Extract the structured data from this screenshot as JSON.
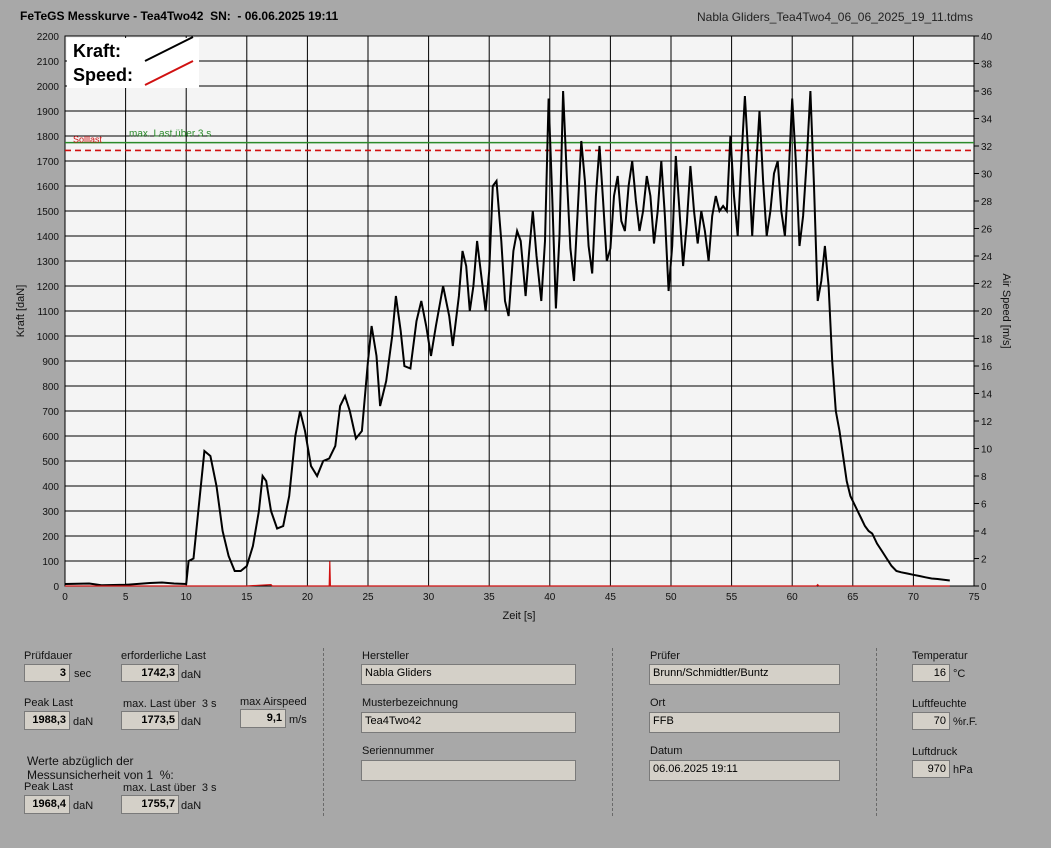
{
  "header": {
    "title": "FeTeGS Messkurve - Tea4Two42  SN:  - 06.06.2025 19:11",
    "file": "Nabla Gliders_Tea4Two4_06_06_2025_19_11.tdms"
  },
  "chart_data": {
    "type": "line",
    "xlabel": "Zeit [s]",
    "ylabel": "Kraft [daN]",
    "y2label": "Air Speed [m/s]",
    "xlim": [
      0,
      75
    ],
    "ylim": [
      0,
      2200
    ],
    "y2lim": [
      0,
      40
    ],
    "x_ticks": [
      0,
      5,
      10,
      15,
      20,
      25,
      30,
      35,
      40,
      45,
      50,
      55,
      60,
      65,
      70,
      75
    ],
    "y_ticks": [
      0,
      100,
      200,
      300,
      400,
      500,
      600,
      700,
      800,
      900,
      1000,
      1100,
      1200,
      1300,
      1400,
      1500,
      1600,
      1700,
      1800,
      1900,
      2000,
      2100,
      2200
    ],
    "y2_ticks": [
      0,
      2,
      4,
      6,
      8,
      10,
      12,
      14,
      16,
      18,
      20,
      22,
      24,
      26,
      28,
      30,
      32,
      34,
      36,
      38,
      40
    ],
    "legend": [
      {
        "name": "Kraft:",
        "color": "#000000"
      },
      {
        "name": "Speed:",
        "color": "#d01010"
      }
    ],
    "reference_lines": [
      {
        "name": "max. Last über  3 s",
        "value": 1773.5,
        "color": "#2a8a2a"
      },
      {
        "name": "Solllast",
        "value": 1742.3,
        "color": "#d01010"
      }
    ],
    "series": [
      {
        "name": "Kraft:",
        "color": "#000000",
        "points": [
          [
            0,
            8
          ],
          [
            2,
            10
          ],
          [
            3,
            3
          ],
          [
            5,
            5
          ],
          [
            7,
            12
          ],
          [
            8,
            14
          ],
          [
            9,
            10
          ],
          [
            10,
            8
          ],
          [
            10.2,
            100
          ],
          [
            10.6,
            110
          ],
          [
            11,
            300
          ],
          [
            11.5,
            540
          ],
          [
            12,
            520
          ],
          [
            12.5,
            400
          ],
          [
            13,
            220
          ],
          [
            13.5,
            120
          ],
          [
            14,
            60
          ],
          [
            14.5,
            60
          ],
          [
            15,
            80
          ],
          [
            15.5,
            160
          ],
          [
            16,
            300
          ],
          [
            16.3,
            440
          ],
          [
            16.6,
            420
          ],
          [
            17,
            300
          ],
          [
            17.5,
            230
          ],
          [
            18,
            240
          ],
          [
            18.5,
            360
          ],
          [
            19,
            600
          ],
          [
            19.4,
            700
          ],
          [
            19.8,
            620
          ],
          [
            20.3,
            480
          ],
          [
            20.8,
            440
          ],
          [
            21.3,
            500
          ],
          [
            21.8,
            510
          ],
          [
            22.3,
            560
          ],
          [
            22.7,
            720
          ],
          [
            23.1,
            760
          ],
          [
            23.5,
            700
          ],
          [
            24,
            590
          ],
          [
            24.5,
            620
          ],
          [
            25,
            900
          ],
          [
            25.3,
            1040
          ],
          [
            25.7,
            920
          ],
          [
            26,
            720
          ],
          [
            26.5,
            820
          ],
          [
            27,
            1000
          ],
          [
            27.3,
            1160
          ],
          [
            27.7,
            1020
          ],
          [
            28,
            880
          ],
          [
            28.5,
            870
          ],
          [
            29,
            1060
          ],
          [
            29.4,
            1140
          ],
          [
            29.8,
            1040
          ],
          [
            30.2,
            920
          ],
          [
            30.6,
            1040
          ],
          [
            31.2,
            1200
          ],
          [
            31.7,
            1080
          ],
          [
            32,
            960
          ],
          [
            32.5,
            1160
          ],
          [
            32.8,
            1340
          ],
          [
            33.1,
            1280
          ],
          [
            33.4,
            1100
          ],
          [
            33.7,
            1200
          ],
          [
            34,
            1380
          ],
          [
            34.3,
            1260
          ],
          [
            34.7,
            1100
          ],
          [
            35,
            1260
          ],
          [
            35.3,
            1600
          ],
          [
            35.6,
            1620
          ],
          [
            36,
            1380
          ],
          [
            36.3,
            1140
          ],
          [
            36.6,
            1080
          ],
          [
            37,
            1340
          ],
          [
            37.3,
            1420
          ],
          [
            37.6,
            1380
          ],
          [
            38,
            1160
          ],
          [
            38.3,
            1340
          ],
          [
            38.6,
            1500
          ],
          [
            38.9,
            1320
          ],
          [
            39.3,
            1140
          ],
          [
            39.6,
            1380
          ],
          [
            39.9,
            1950
          ],
          [
            40.2,
            1560
          ],
          [
            40.5,
            1110
          ],
          [
            40.8,
            1400
          ],
          [
            41.1,
            1980
          ],
          [
            41.4,
            1640
          ],
          [
            41.7,
            1350
          ],
          [
            42,
            1220
          ],
          [
            42.3,
            1500
          ],
          [
            42.6,
            1780
          ],
          [
            42.9,
            1620
          ],
          [
            43.2,
            1360
          ],
          [
            43.5,
            1250
          ],
          [
            43.8,
            1560
          ],
          [
            44.1,
            1760
          ],
          [
            44.4,
            1540
          ],
          [
            44.7,
            1300
          ],
          [
            45,
            1350
          ],
          [
            45.3,
            1560
          ],
          [
            45.6,
            1640
          ],
          [
            45.9,
            1460
          ],
          [
            46.2,
            1420
          ],
          [
            46.5,
            1600
          ],
          [
            46.8,
            1700
          ],
          [
            47.1,
            1540
          ],
          [
            47.4,
            1420
          ],
          [
            47.7,
            1500
          ],
          [
            48,
            1640
          ],
          [
            48.3,
            1560
          ],
          [
            48.6,
            1370
          ],
          [
            48.9,
            1500
          ],
          [
            49.2,
            1700
          ],
          [
            49.5,
            1480
          ],
          [
            49.8,
            1180
          ],
          [
            50.1,
            1360
          ],
          [
            50.4,
            1720
          ],
          [
            50.7,
            1500
          ],
          [
            51,
            1280
          ],
          [
            51.3,
            1450
          ],
          [
            51.6,
            1680
          ],
          [
            51.9,
            1500
          ],
          [
            52.2,
            1370
          ],
          [
            52.5,
            1500
          ],
          [
            52.8,
            1420
          ],
          [
            53.1,
            1300
          ],
          [
            53.4,
            1480
          ],
          [
            53.7,
            1560
          ],
          [
            54,
            1500
          ],
          [
            54.3,
            1520
          ],
          [
            54.6,
            1500
          ],
          [
            54.9,
            1800
          ],
          [
            55.2,
            1560
          ],
          [
            55.5,
            1400
          ],
          [
            55.8,
            1700
          ],
          [
            56.1,
            1960
          ],
          [
            56.4,
            1700
          ],
          [
            56.7,
            1400
          ],
          [
            57,
            1650
          ],
          [
            57.3,
            1900
          ],
          [
            57.6,
            1620
          ],
          [
            57.9,
            1400
          ],
          [
            58.2,
            1500
          ],
          [
            58.5,
            1650
          ],
          [
            58.8,
            1700
          ],
          [
            59.1,
            1500
          ],
          [
            59.4,
            1400
          ],
          [
            59.7,
            1640
          ],
          [
            60,
            1950
          ],
          [
            60.3,
            1700
          ],
          [
            60.6,
            1360
          ],
          [
            60.9,
            1480
          ],
          [
            61.2,
            1700
          ],
          [
            61.5,
            1980
          ],
          [
            61.8,
            1600
          ],
          [
            62.1,
            1140
          ],
          [
            62.4,
            1220
          ],
          [
            62.7,
            1360
          ],
          [
            63,
            1200
          ],
          [
            63.3,
            900
          ],
          [
            63.6,
            700
          ],
          [
            63.9,
            620
          ],
          [
            64.2,
            520
          ],
          [
            64.5,
            420
          ],
          [
            64.8,
            360
          ],
          [
            65.1,
            330
          ],
          [
            65.4,
            300
          ],
          [
            65.7,
            270
          ],
          [
            66,
            240
          ],
          [
            66.3,
            220
          ],
          [
            66.6,
            210
          ],
          [
            67,
            170
          ],
          [
            67.4,
            140
          ],
          [
            67.8,
            110
          ],
          [
            68.2,
            80
          ],
          [
            68.6,
            60
          ],
          [
            69,
            55
          ],
          [
            69.5,
            50
          ],
          [
            70,
            45
          ],
          [
            70.5,
            40
          ],
          [
            71,
            35
          ],
          [
            71.5,
            30
          ],
          [
            72,
            28
          ],
          [
            72.5,
            25
          ],
          [
            73,
            22
          ]
        ]
      },
      {
        "name": "Speed:",
        "color": "#d01010",
        "points": [
          [
            0,
            0
          ],
          [
            10,
            0
          ],
          [
            15,
            0
          ],
          [
            17,
            0.1
          ],
          [
            17.1,
            0
          ],
          [
            21.8,
            0
          ],
          [
            21.85,
            1.8
          ],
          [
            21.9,
            0
          ],
          [
            30,
            0
          ],
          [
            40,
            0
          ],
          [
            50,
            0
          ],
          [
            60,
            0
          ],
          [
            62,
            0
          ],
          [
            62.1,
            0.1
          ],
          [
            62.2,
            0
          ],
          [
            73,
            0
          ]
        ]
      }
    ]
  },
  "results": {
    "pruefdauer_label": "Prüfdauer",
    "pruefdauer_value": "3",
    "pruefdauer_unit": "sec",
    "erf_last_label": "erforderliche Last",
    "erf_last_value": "1742,3",
    "erf_last_unit": "daN",
    "peak_label": "Peak Last",
    "peak_value": "1988,3",
    "peak_unit": "daN",
    "maxlast_label": "max. Last über  3 s",
    "maxlast_value": "1773,5",
    "maxlast_unit": "daN",
    "airspeed_label": "max Airspeed",
    "airspeed_value": "9,1",
    "airspeed_unit": "m/s",
    "werte_line1": "Werte abzüglich der",
    "werte_line2": "Messunsicherheit von 1  %:",
    "peak2_label": "Peak Last",
    "peak2_value": "1968,4",
    "peak2_unit": "daN",
    "maxlast2_label": "max. Last über  3 s",
    "maxlast2_value": "1755,7",
    "maxlast2_unit": "daN"
  },
  "info": {
    "hersteller_label": "Hersteller",
    "hersteller_value": "Nabla Gliders",
    "muster_label": "Musterbezeichnung",
    "muster_value": "Tea4Two42",
    "serien_label": "Seriennummer",
    "serien_value": "",
    "pruefer_label": "Prüfer",
    "pruefer_value": "Brunn/Schmidtler/Buntz",
    "ort_label": "Ort",
    "ort_value": "FFB",
    "datum_label": "Datum",
    "datum_value": "06.06.2025 19:11"
  },
  "env": {
    "temp_label": "Temperatur",
    "temp_value": "16",
    "temp_unit": "°C",
    "feuchte_label": "Luftfeuchte",
    "feuchte_value": "70",
    "feuchte_unit": "%r.F.",
    "druck_label": "Luftdruck",
    "druck_value": "970",
    "druck_unit": "hPa"
  }
}
